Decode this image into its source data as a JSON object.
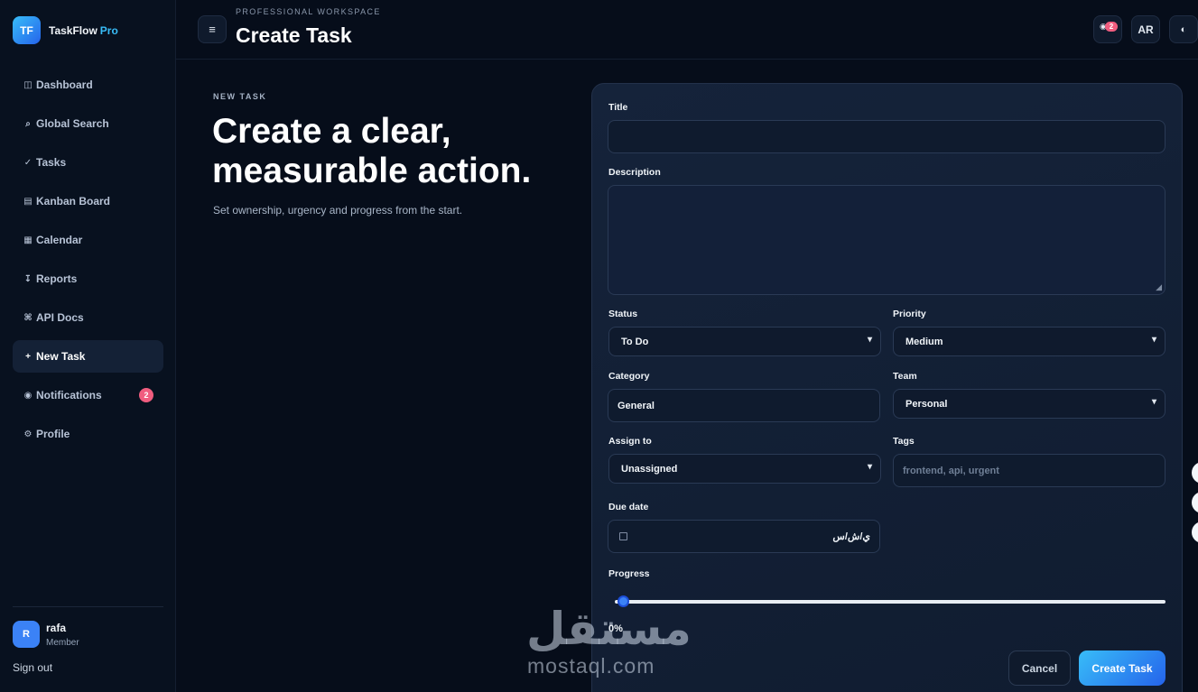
{
  "brand": {
    "logo": "TF",
    "name": "TaskFlow",
    "suffix": "Pro"
  },
  "sidebar": {
    "items": [
      {
        "icon": "◫",
        "label": "Dashboard",
        "active": false
      },
      {
        "icon": "⌕",
        "label": "Global Search",
        "active": false
      },
      {
        "icon": "✓",
        "label": "Tasks",
        "active": false
      },
      {
        "icon": "▤",
        "label": "Kanban Board",
        "active": false
      },
      {
        "icon": "▦",
        "label": "Calendar",
        "active": false
      },
      {
        "icon": "↧",
        "label": "Reports",
        "active": false
      },
      {
        "icon": "⌘",
        "label": "API Docs",
        "active": false
      },
      {
        "icon": "+",
        "label": "New Task",
        "active": true
      },
      {
        "icon": "◉",
        "label": "Notifications",
        "active": false,
        "badge": "2"
      },
      {
        "icon": "⚙",
        "label": "Profile",
        "active": false
      }
    ],
    "user": {
      "initial": "R",
      "name": "rafa",
      "role": "Member"
    },
    "signout": "Sign out"
  },
  "topbar": {
    "menu_icon": "≡",
    "eyebrow": "PROFESSIONAL WORKSPACE",
    "title": "Create Task",
    "notif_badge": "2",
    "lang": "AR",
    "theme_icon": "◐"
  },
  "hero": {
    "eyebrow": "NEW TASK",
    "title": "Create a clear, measurable action.",
    "subtitle": "Set ownership, urgency and progress from the start."
  },
  "form": {
    "title_label": "Title",
    "title_value": "",
    "description_label": "Description",
    "description_value": "",
    "status_label": "Status",
    "status_value": "To Do",
    "priority_label": "Priority",
    "priority_value": "Medium",
    "category_label": "Category",
    "category_value": "General",
    "team_label": "Team",
    "team_value": "Personal",
    "assign_label": "Assign to",
    "assign_value": "Unassigned",
    "tags_label": "Tags",
    "tags_placeholder": "frontend, api, urgent",
    "due_label": "Due date",
    "due_value": "ي/ش/س",
    "progress_label": "Progress",
    "progress_value": 0,
    "progress_text": "0%",
    "cancel": "Cancel",
    "submit": "Create Task"
  },
  "watermark": {
    "arabic": "مستقل",
    "latin": "mostaql.com"
  },
  "colors": {
    "accent": "#3b82f6",
    "accent_light": "#38bdf8",
    "badge": "#f05d7f",
    "bg": "#060d1a"
  }
}
